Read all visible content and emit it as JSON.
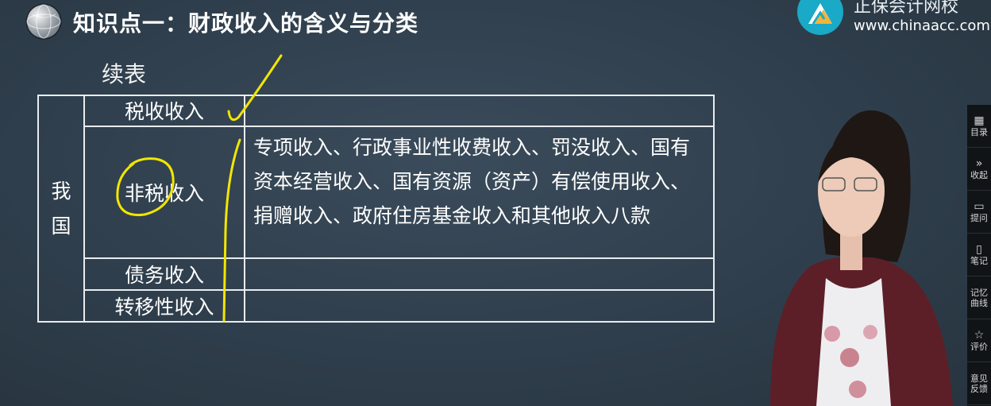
{
  "header": {
    "title": "知识点一：财政收入的含义与分类",
    "brand_name": "正保会计网校",
    "brand_url": "www.chinaacc.com"
  },
  "slide": {
    "continued_label": "续表",
    "country_label": "我国",
    "rows": [
      {
        "type": "税收收入",
        "desc": ""
      },
      {
        "type": "非税收入",
        "desc": "专项收入、行政事业性收费收入、罚没收入、国有资本经营收入、国有资源（资产）有偿使用收入、捐赠收入、政府住房基金收入和其他收入八款"
      },
      {
        "type": "债务收入",
        "desc": ""
      },
      {
        "type": "转移性收入",
        "desc": ""
      }
    ]
  },
  "sidebar": {
    "items": [
      {
        "icon": "grid-icon",
        "label": "目录"
      },
      {
        "icon": "chevrons-right-icon",
        "label": "收起"
      },
      {
        "icon": "chat-icon",
        "label": "提问"
      },
      {
        "icon": "notebook-icon",
        "label": "笔记"
      },
      {
        "icon": "",
        "label": "记忆曲线"
      },
      {
        "icon": "star-icon",
        "label": "评价"
      },
      {
        "icon": "",
        "label": "意见反馈"
      }
    ]
  },
  "colors": {
    "background": "#2f3e4c",
    "annotation": "#f2e600",
    "brand": "#1aa9c6",
    "sidebar": "#111417"
  }
}
